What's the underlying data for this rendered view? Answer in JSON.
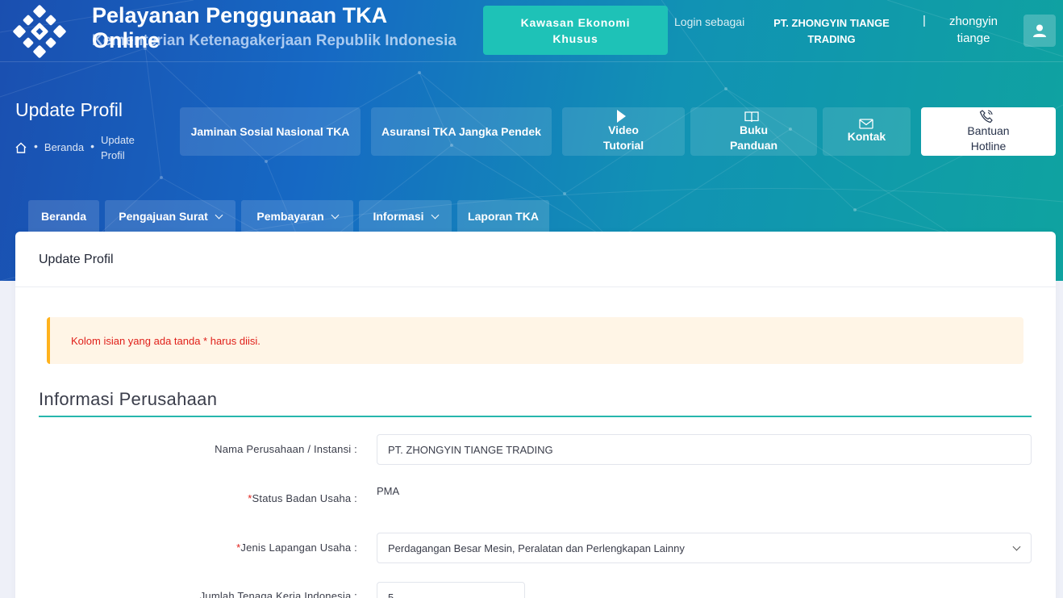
{
  "header": {
    "title": "Pelayanan Penggunaan TKA Online",
    "subtitle": "Kementerian Ketenagakerjaan Republik Indonesia",
    "kek_button": "Kawasan Ekonomi Khusus",
    "login_label": "Login sebagai",
    "company_name": "PT. ZHONGYIN TIANGE TRADING",
    "separator": "|",
    "username": "zhongyin tiange",
    "avatar_icon": "user-icon"
  },
  "page": {
    "title": "Update Profil",
    "breadcrumb": {
      "home_icon": "home-icon",
      "items": [
        "Beranda",
        "Update Profil"
      ]
    }
  },
  "quick_links": [
    {
      "label": "Jaminan Sosial Nasional TKA"
    },
    {
      "label": "Asuransi TKA Jangka Pendek"
    },
    {
      "label": "Video Tutorial",
      "icon": "play-icon"
    },
    {
      "label": "Buku Panduan",
      "icon": "book-icon"
    },
    {
      "label": "Kontak",
      "icon": "mail-icon"
    },
    {
      "label": "Bantuan Hotline",
      "icon": "phone-icon"
    }
  ],
  "nav": [
    {
      "label": "Beranda"
    },
    {
      "label": "Pengajuan Surat",
      "dropdown": true
    },
    {
      "label": "Pembayaran",
      "dropdown": true
    },
    {
      "label": "Informasi",
      "dropdown": true
    },
    {
      "label": "Laporan TKA"
    }
  ],
  "card": {
    "header": "Update Profil",
    "alert": "Kolom isian yang ada tanda * harus diisi.",
    "section_title": "Informasi Perusahaan",
    "fields": [
      {
        "label": "Nama Perusahaan / Instansi :",
        "required": false,
        "value": "PT. ZHONGYIN TIANGE TRADING"
      },
      {
        "label": "Status Badan Usaha :",
        "required": true,
        "value": "PMA"
      },
      {
        "label": "Jenis Lapangan Usaha :",
        "required": true,
        "value": "Perdagangan Besar Mesin, Peralatan dan Perlengkapan Lainny"
      },
      {
        "label": "Jumlah Tenaga Kerja Indonesia :",
        "required": false,
        "value": "5"
      }
    ],
    "required_mark": "*"
  },
  "colors": {
    "accent_teal": "#1ec2b7",
    "section_line": "#27b6ad",
    "alert_border": "#ffb21d",
    "alert_bg": "#fff5e6",
    "required": "#e0201a"
  }
}
